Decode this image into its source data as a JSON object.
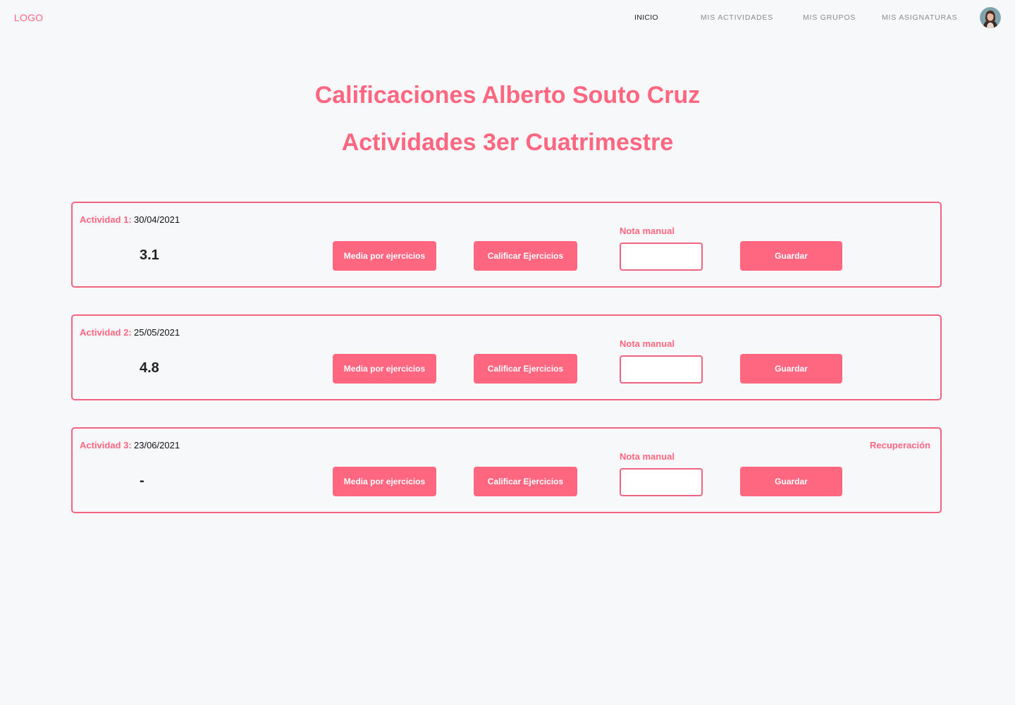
{
  "navbar": {
    "logo": "LOGO",
    "links": [
      "INICIO",
      "MIS ACTIVIDADES",
      "MIS GRUPOS",
      "MIS ASIGNATURAS"
    ],
    "active_link": "INICIO"
  },
  "page": {
    "title": "Calificaciones Alberto Souto Cruz",
    "subtitle": "Actividades 3er Cuatrimestre"
  },
  "activities": [
    {
      "label": "Actividad 1:",
      "date": "30/04/2021",
      "score": "3.1",
      "media_button": "Media por ejercicios",
      "calificar_button": "Calificar Ejercicios",
      "nota_label": "Nota manual",
      "nota_value": "",
      "guardar_button": "Guardar"
    },
    {
      "label": "Actividad 2:",
      "date": "25/05/2021",
      "score": "4.8",
      "media_button": "Media por ejercicios",
      "calificar_button": "Calificar Ejercicios",
      "nota_label": "Nota manual",
      "nota_value": "",
      "guardar_button": "Guardar"
    },
    {
      "label": "Actividad 3:",
      "date": "23/06/2021",
      "score": "-",
      "media_button": "Media por ejercicios",
      "calificar_button": "Calificar Ejercicios",
      "nota_label": "Nota manual",
      "nota_value": "",
      "guardar_button": "Guardar",
      "recuperacion": "Recuperación"
    }
  ],
  "colors": {
    "accent": "#ff6680",
    "border": "#f06480",
    "background": "#f7f8fa"
  }
}
